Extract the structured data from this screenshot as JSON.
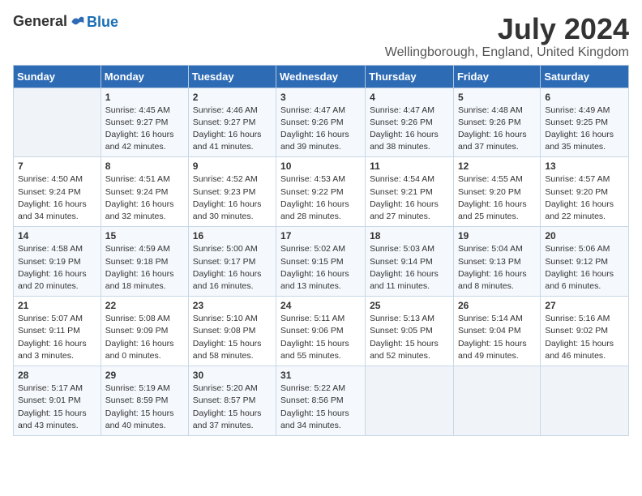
{
  "logo": {
    "general": "General",
    "blue": "Blue"
  },
  "title": "July 2024",
  "location": "Wellingborough, England, United Kingdom",
  "days_of_week": [
    "Sunday",
    "Monday",
    "Tuesday",
    "Wednesday",
    "Thursday",
    "Friday",
    "Saturday"
  ],
  "weeks": [
    [
      {
        "day": "",
        "content": ""
      },
      {
        "day": "1",
        "content": "Sunrise: 4:45 AM\nSunset: 9:27 PM\nDaylight: 16 hours\nand 42 minutes."
      },
      {
        "day": "2",
        "content": "Sunrise: 4:46 AM\nSunset: 9:27 PM\nDaylight: 16 hours\nand 41 minutes."
      },
      {
        "day": "3",
        "content": "Sunrise: 4:47 AM\nSunset: 9:26 PM\nDaylight: 16 hours\nand 39 minutes."
      },
      {
        "day": "4",
        "content": "Sunrise: 4:47 AM\nSunset: 9:26 PM\nDaylight: 16 hours\nand 38 minutes."
      },
      {
        "day": "5",
        "content": "Sunrise: 4:48 AM\nSunset: 9:26 PM\nDaylight: 16 hours\nand 37 minutes."
      },
      {
        "day": "6",
        "content": "Sunrise: 4:49 AM\nSunset: 9:25 PM\nDaylight: 16 hours\nand 35 minutes."
      }
    ],
    [
      {
        "day": "7",
        "content": "Sunrise: 4:50 AM\nSunset: 9:24 PM\nDaylight: 16 hours\nand 34 minutes."
      },
      {
        "day": "8",
        "content": "Sunrise: 4:51 AM\nSunset: 9:24 PM\nDaylight: 16 hours\nand 32 minutes."
      },
      {
        "day": "9",
        "content": "Sunrise: 4:52 AM\nSunset: 9:23 PM\nDaylight: 16 hours\nand 30 minutes."
      },
      {
        "day": "10",
        "content": "Sunrise: 4:53 AM\nSunset: 9:22 PM\nDaylight: 16 hours\nand 28 minutes."
      },
      {
        "day": "11",
        "content": "Sunrise: 4:54 AM\nSunset: 9:21 PM\nDaylight: 16 hours\nand 27 minutes."
      },
      {
        "day": "12",
        "content": "Sunrise: 4:55 AM\nSunset: 9:20 PM\nDaylight: 16 hours\nand 25 minutes."
      },
      {
        "day": "13",
        "content": "Sunrise: 4:57 AM\nSunset: 9:20 PM\nDaylight: 16 hours\nand 22 minutes."
      }
    ],
    [
      {
        "day": "14",
        "content": "Sunrise: 4:58 AM\nSunset: 9:19 PM\nDaylight: 16 hours\nand 20 minutes."
      },
      {
        "day": "15",
        "content": "Sunrise: 4:59 AM\nSunset: 9:18 PM\nDaylight: 16 hours\nand 18 minutes."
      },
      {
        "day": "16",
        "content": "Sunrise: 5:00 AM\nSunset: 9:17 PM\nDaylight: 16 hours\nand 16 minutes."
      },
      {
        "day": "17",
        "content": "Sunrise: 5:02 AM\nSunset: 9:15 PM\nDaylight: 16 hours\nand 13 minutes."
      },
      {
        "day": "18",
        "content": "Sunrise: 5:03 AM\nSunset: 9:14 PM\nDaylight: 16 hours\nand 11 minutes."
      },
      {
        "day": "19",
        "content": "Sunrise: 5:04 AM\nSunset: 9:13 PM\nDaylight: 16 hours\nand 8 minutes."
      },
      {
        "day": "20",
        "content": "Sunrise: 5:06 AM\nSunset: 9:12 PM\nDaylight: 16 hours\nand 6 minutes."
      }
    ],
    [
      {
        "day": "21",
        "content": "Sunrise: 5:07 AM\nSunset: 9:11 PM\nDaylight: 16 hours\nand 3 minutes."
      },
      {
        "day": "22",
        "content": "Sunrise: 5:08 AM\nSunset: 9:09 PM\nDaylight: 16 hours\nand 0 minutes."
      },
      {
        "day": "23",
        "content": "Sunrise: 5:10 AM\nSunset: 9:08 PM\nDaylight: 15 hours\nand 58 minutes."
      },
      {
        "day": "24",
        "content": "Sunrise: 5:11 AM\nSunset: 9:06 PM\nDaylight: 15 hours\nand 55 minutes."
      },
      {
        "day": "25",
        "content": "Sunrise: 5:13 AM\nSunset: 9:05 PM\nDaylight: 15 hours\nand 52 minutes."
      },
      {
        "day": "26",
        "content": "Sunrise: 5:14 AM\nSunset: 9:04 PM\nDaylight: 15 hours\nand 49 minutes."
      },
      {
        "day": "27",
        "content": "Sunrise: 5:16 AM\nSunset: 9:02 PM\nDaylight: 15 hours\nand 46 minutes."
      }
    ],
    [
      {
        "day": "28",
        "content": "Sunrise: 5:17 AM\nSunset: 9:01 PM\nDaylight: 15 hours\nand 43 minutes."
      },
      {
        "day": "29",
        "content": "Sunrise: 5:19 AM\nSunset: 8:59 PM\nDaylight: 15 hours\nand 40 minutes."
      },
      {
        "day": "30",
        "content": "Sunrise: 5:20 AM\nSunset: 8:57 PM\nDaylight: 15 hours\nand 37 minutes."
      },
      {
        "day": "31",
        "content": "Sunrise: 5:22 AM\nSunset: 8:56 PM\nDaylight: 15 hours\nand 34 minutes."
      },
      {
        "day": "",
        "content": ""
      },
      {
        "day": "",
        "content": ""
      },
      {
        "day": "",
        "content": ""
      }
    ]
  ]
}
